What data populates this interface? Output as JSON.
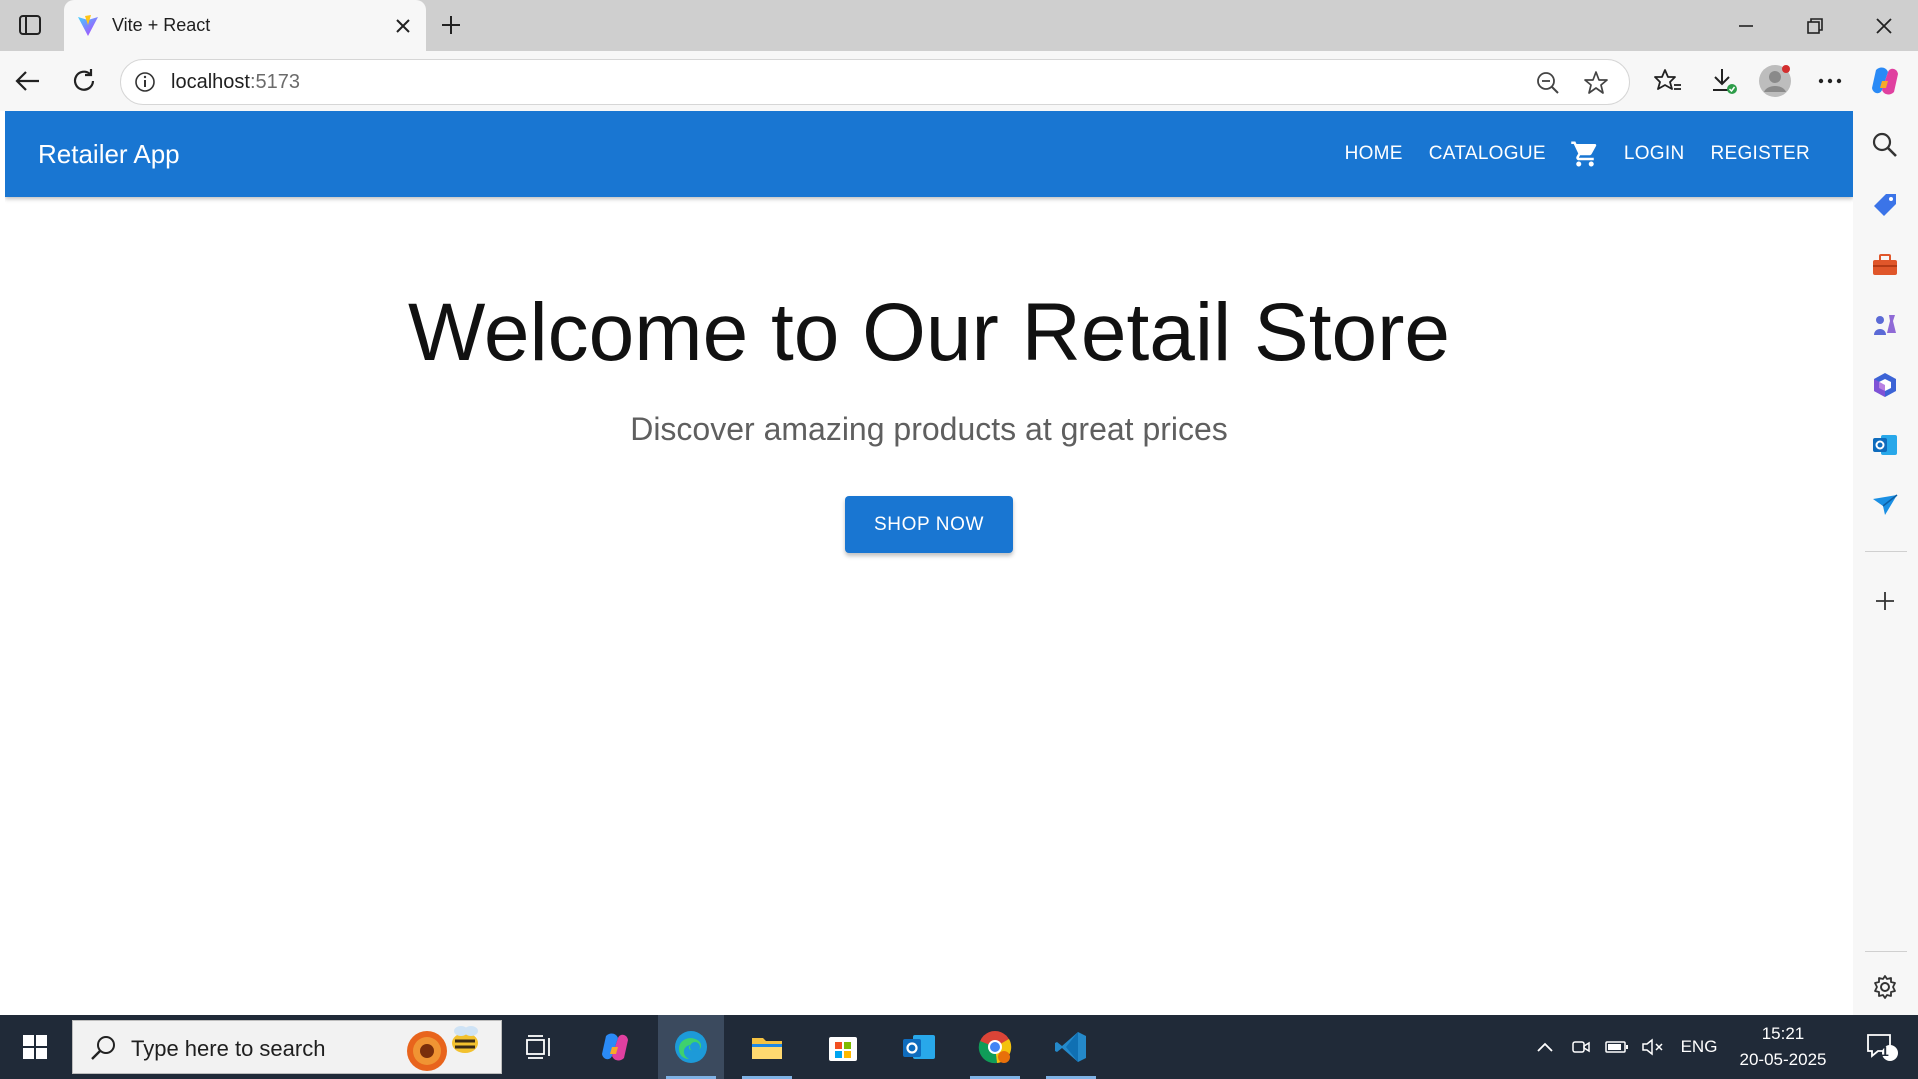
{
  "browser": {
    "tab_title": "Vite + React",
    "address_host": "localhost",
    "address_port": ":5173"
  },
  "app": {
    "title": "Retailer App",
    "nav": {
      "home": "HOME",
      "catalogue": "CATALOGUE",
      "login": "LOGIN",
      "register": "REGISTER"
    },
    "hero": {
      "title": "Welcome to Our Retail Store",
      "subtitle": "Discover amazing products at great prices",
      "cta": "SHOP NOW"
    },
    "colors": {
      "primary": "#1976d2"
    }
  },
  "taskbar": {
    "search_placeholder": "Type here to search",
    "language": "ENG",
    "time": "15:21",
    "date": "20-05-2025",
    "notification_count": "1"
  }
}
